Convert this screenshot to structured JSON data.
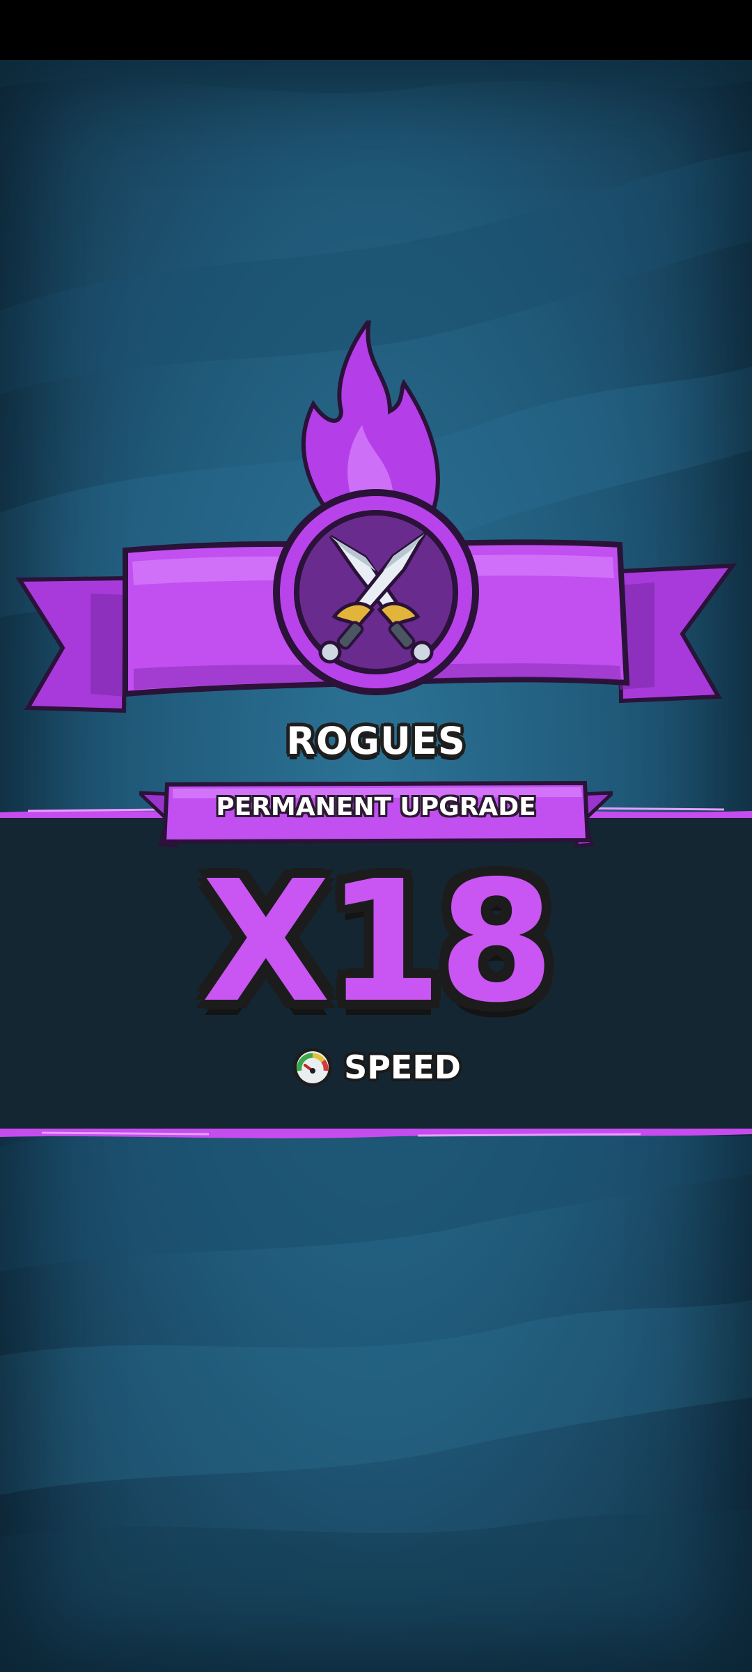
{
  "reward": {
    "unit_name": "ROGUES",
    "upgrade_label": "PERMANENT UPGRADE",
    "multiplier": "X18",
    "stat_label": "SPEED"
  },
  "icons": {
    "emblem": "crossed-daggers-icon",
    "stat": "speedometer-icon"
  },
  "colors": {
    "accent_purple": "#c955f2",
    "banner_purple": "#b84ae6",
    "background_teal": "#205a7a",
    "band_dark": "#142632"
  }
}
